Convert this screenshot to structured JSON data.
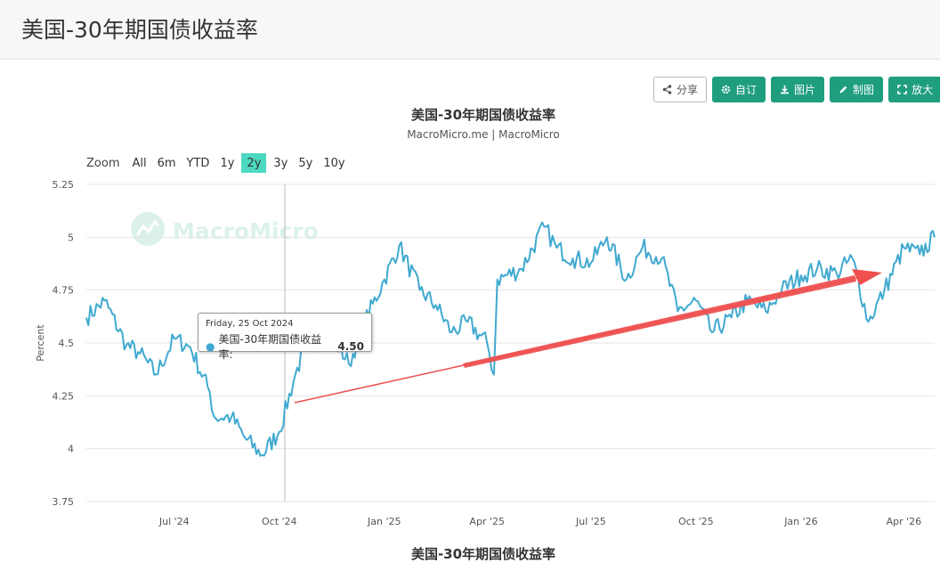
{
  "page": {
    "title": "美国-30年期国债收益率"
  },
  "toolbar": {
    "share": "分享",
    "customize": "自订",
    "image": "图片",
    "draw": "制图",
    "enlarge": "放大"
  },
  "range_selector": {
    "label": "Zoom",
    "options": [
      "All",
      "6m",
      "YTD",
      "1y",
      "2y",
      "3y",
      "5y",
      "10y"
    ],
    "selected": "2y"
  },
  "watermark": {
    "text": "MacroMicro"
  },
  "tooltip": {
    "date": "Friday, 25 Oct 2024",
    "series": "美国-30年期国债收益率:",
    "value": "4.50"
  },
  "bottom_caption": "美国-30年期国债收益率",
  "colors": {
    "series": "#40a9d0",
    "arrow": "#ee5050",
    "accent_button": "#1f9e7e",
    "active_zoom": "#4dd9c0"
  },
  "chart_data": {
    "type": "line",
    "title": "美国-30年期国债收益率",
    "subtitle": "MacroMicro.me | MacroMicro",
    "ylabel": "Percent",
    "ylim": [
      3.75,
      5.25
    ],
    "yticks": [
      "5.25",
      "5",
      "4.75",
      "4.5",
      "4.25",
      "4",
      "3.75"
    ],
    "xticks": [
      "Jul '24",
      "Oct '24",
      "Jan '25",
      "Apr '25",
      "Jul '25",
      "Oct '25",
      "Jan '26",
      "Apr '26"
    ],
    "grid": true,
    "legend": "none",
    "series": [
      {
        "x": [
          "2024-04-15",
          "2024-05-01",
          "2024-05-20",
          "2024-06-01",
          "2024-06-15",
          "2024-07-01",
          "2024-07-15",
          "2024-08-01",
          "2024-08-05",
          "2024-08-20",
          "2024-09-01",
          "2024-09-16",
          "2024-10-01",
          "2024-10-15",
          "2024-10-25",
          "2024-11-01",
          "2024-11-15",
          "2024-12-01",
          "2024-12-15",
          "2025-01-01",
          "2025-01-14",
          "2025-02-01",
          "2025-02-15",
          "2025-03-01",
          "2025-03-15",
          "2025-04-01",
          "2025-04-07",
          "2025-04-10",
          "2025-05-01",
          "2025-05-21",
          "2025-06-01",
          "2025-06-15",
          "2025-07-01",
          "2025-07-15",
          "2025-08-01",
          "2025-08-15",
          "2025-09-01",
          "2025-09-15",
          "2025-10-01",
          "2025-10-15",
          "2025-11-01",
          "2025-11-15",
          "2025-12-01",
          "2025-12-15",
          "2026-01-01",
          "2026-01-15",
          "2026-02-01",
          "2026-02-15",
          "2026-03-01",
          "2026-03-15",
          "2026-04-01",
          "2026-04-15",
          "2026-04-28"
        ],
        "y": [
          4.62,
          4.7,
          4.49,
          4.45,
          4.35,
          4.52,
          4.48,
          4.27,
          4.15,
          4.15,
          4.05,
          3.97,
          4.08,
          4.35,
          4.5,
          4.49,
          4.55,
          4.4,
          4.6,
          4.8,
          4.96,
          4.75,
          4.68,
          4.55,
          4.6,
          4.5,
          4.35,
          4.8,
          4.85,
          5.05,
          4.95,
          4.9,
          4.88,
          5.0,
          4.8,
          4.95,
          4.9,
          4.65,
          4.7,
          4.55,
          4.62,
          4.7,
          4.65,
          4.75,
          4.82,
          4.85,
          4.83,
          4.9,
          4.6,
          4.75,
          4.95,
          4.92,
          5.0
        ]
      }
    ],
    "annotation": "red trend arrow from Oct 2024 (~4.23) rising to Mar 2026 (~4.90)"
  }
}
